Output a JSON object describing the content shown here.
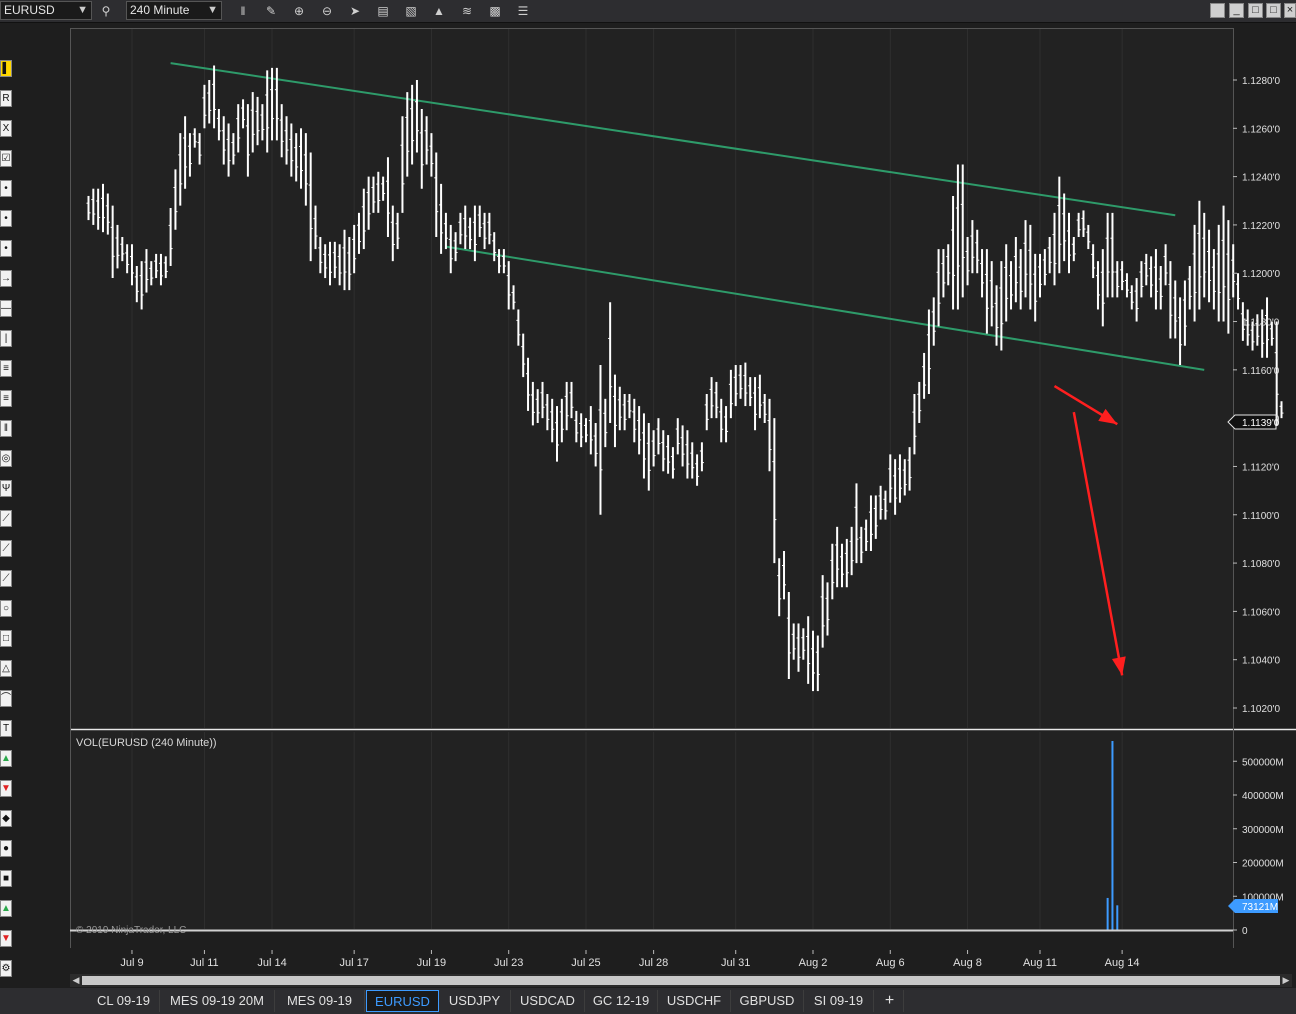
{
  "toolbar": {
    "instrument": "EURUSD",
    "interval": "240 Minute",
    "icons": [
      "search-icon",
      "bars-type-icon",
      "draw-icon",
      "zoom-in-icon",
      "zoom-out-icon",
      "pointer-icon",
      "data-box-icon",
      "properties-icon",
      "indicators-icon",
      "strategies-icon",
      "templates-icon",
      "grid-icon"
    ]
  },
  "chart_data": {
    "type": "ohlc-bar",
    "instrument": "EURUSD",
    "interval": "240 Minute",
    "price_axis": {
      "min": 1.101,
      "max": 1.1295,
      "ticks": [
        "1.1280'0",
        "1.1260'0",
        "1.1240'0",
        "1.1220'0",
        "1.1200'0",
        "1.1180'0",
        "1.1160'0",
        "1.1140'0",
        "1.1120'0",
        "1.1100'0",
        "1.1080'0",
        "1.1060'0",
        "1.1040'0",
        "1.1020'0"
      ],
      "tick_values": [
        1.128,
        1.126,
        1.124,
        1.122,
        1.12,
        1.118,
        1.116,
        1.114,
        1.112,
        1.11,
        1.108,
        1.106,
        1.104,
        1.102
      ],
      "last_price_label": "1.1139'0",
      "last_price": 1.1139
    },
    "x_axis": {
      "labels": [
        "Jul 9",
        "Jul 11",
        "Jul 14",
        "Jul 17",
        "Jul 19",
        "Jul 23",
        "Jul 25",
        "Jul 28",
        "Jul 31",
        "Aug 2",
        "Aug 6",
        "Aug 8",
        "Aug 11",
        "Aug 14"
      ],
      "bar_index": [
        9,
        24,
        38,
        55,
        71,
        87,
        103,
        117,
        134,
        150,
        166,
        182,
        197,
        214
      ]
    },
    "bars": [
      [
        1.1222,
        1.1232
      ],
      [
        1.122,
        1.1235
      ],
      [
        1.1218,
        1.1235
      ],
      [
        1.1217,
        1.1237
      ],
      [
        1.1216,
        1.1233
      ],
      [
        1.1198,
        1.1228
      ],
      [
        1.1202,
        1.122
      ],
      [
        1.1205,
        1.1215
      ],
      [
        1.12,
        1.1212
      ],
      [
        1.1195,
        1.1212
      ],
      [
        1.1188,
        1.1203
      ],
      [
        1.1185,
        1.1205
      ],
      [
        1.1192,
        1.121
      ],
      [
        1.1195,
        1.1205
      ],
      [
        1.1198,
        1.1208
      ],
      [
        1.1195,
        1.1208
      ],
      [
        1.1198,
        1.1207
      ],
      [
        1.1203,
        1.1227
      ],
      [
        1.1218,
        1.1243
      ],
      [
        1.1228,
        1.1258
      ],
      [
        1.1235,
        1.1265
      ],
      [
        1.124,
        1.1258
      ],
      [
        1.1252,
        1.126
      ],
      [
        1.1245,
        1.1258
      ],
      [
        1.126,
        1.1278
      ],
      [
        1.1262,
        1.128
      ],
      [
        1.126,
        1.1286
      ],
      [
        1.1255,
        1.1268
      ],
      [
        1.1245,
        1.1265
      ],
      [
        1.124,
        1.1262
      ],
      [
        1.1245,
        1.1258
      ],
      [
        1.125,
        1.127
      ],
      [
        1.126,
        1.1272
      ],
      [
        1.124,
        1.127
      ],
      [
        1.125,
        1.1275
      ],
      [
        1.1253,
        1.1273
      ],
      [
        1.1255,
        1.127
      ],
      [
        1.125,
        1.1284
      ],
      [
        1.1255,
        1.1285
      ],
      [
        1.1255,
        1.1285
      ],
      [
        1.1248,
        1.127
      ],
      [
        1.1245,
        1.1265
      ],
      [
        1.124,
        1.1262
      ],
      [
        1.1238,
        1.1258
      ],
      [
        1.1235,
        1.126
      ],
      [
        1.1228,
        1.1258
      ],
      [
        1.1205,
        1.125
      ],
      [
        1.121,
        1.1228
      ],
      [
        1.12,
        1.1215
      ],
      [
        1.1198,
        1.1212
      ],
      [
        1.1195,
        1.1213
      ],
      [
        1.1198,
        1.1213
      ],
      [
        1.1195,
        1.1212
      ],
      [
        1.1193,
        1.1218
      ],
      [
        1.1193,
        1.1215
      ],
      [
        1.12,
        1.122
      ],
      [
        1.1208,
        1.1225
      ],
      [
        1.121,
        1.1235
      ],
      [
        1.1218,
        1.124
      ],
      [
        1.1225,
        1.124
      ],
      [
        1.1225,
        1.1242
      ],
      [
        1.123,
        1.124
      ],
      [
        1.1215,
        1.1248
      ],
      [
        1.1205,
        1.1228
      ],
      [
        1.121,
        1.1225
      ],
      [
        1.1225,
        1.1265
      ],
      [
        1.124,
        1.1275
      ],
      [
        1.1245,
        1.1278
      ],
      [
        1.125,
        1.128
      ],
      [
        1.1235,
        1.1268
      ],
      [
        1.1245,
        1.1265
      ],
      [
        1.124,
        1.1258
      ],
      [
        1.1215,
        1.125
      ],
      [
        1.1208,
        1.1237
      ],
      [
        1.121,
        1.1225
      ],
      [
        1.12,
        1.122
      ],
      [
        1.1205,
        1.1217
      ],
      [
        1.1212,
        1.1225
      ],
      [
        1.121,
        1.1228
      ],
      [
        1.121,
        1.1223
      ],
      [
        1.1205,
        1.1228
      ],
      [
        1.1215,
        1.1228
      ],
      [
        1.121,
        1.1225
      ],
      [
        1.1212,
        1.1225
      ],
      [
        1.1205,
        1.1217
      ],
      [
        1.12,
        1.121
      ],
      [
        1.12,
        1.121
      ],
      [
        1.1185,
        1.1205
      ],
      [
        1.1185,
        1.1195
      ],
      [
        1.117,
        1.1185
      ],
      [
        1.1157,
        1.1175
      ],
      [
        1.1143,
        1.1165
      ],
      [
        1.1137,
        1.1155
      ],
      [
        1.1138,
        1.1152
      ],
      [
        1.114,
        1.1155
      ],
      [
        1.1135,
        1.115
      ],
      [
        1.113,
        1.1148
      ],
      [
        1.1122,
        1.1145
      ],
      [
        1.113,
        1.1148
      ],
      [
        1.1135,
        1.1155
      ],
      [
        1.114,
        1.1155
      ],
      [
        1.113,
        1.1143
      ],
      [
        1.1128,
        1.1142
      ],
      [
        1.113,
        1.114
      ],
      [
        1.1125,
        1.1145
      ],
      [
        1.112,
        1.1138
      ],
      [
        1.11,
        1.1162
      ],
      [
        1.1128,
        1.1148
      ],
      [
        1.1138,
        1.1188
      ],
      [
        1.1128,
        1.1158
      ],
      [
        1.1135,
        1.1153
      ],
      [
        1.1135,
        1.115
      ],
      [
        1.114,
        1.115
      ],
      [
        1.113,
        1.1148
      ],
      [
        1.1125,
        1.1145
      ],
      [
        1.1115,
        1.1142
      ],
      [
        1.111,
        1.1138
      ],
      [
        1.112,
        1.1135
      ],
      [
        1.1125,
        1.114
      ],
      [
        1.1118,
        1.1135
      ],
      [
        1.1117,
        1.1133
      ],
      [
        1.1115,
        1.1128
      ],
      [
        1.1125,
        1.114
      ],
      [
        1.112,
        1.1137
      ],
      [
        1.1115,
        1.1135
      ],
      [
        1.1115,
        1.113
      ],
      [
        1.1112,
        1.1125
      ],
      [
        1.1118,
        1.113
      ],
      [
        1.1135,
        1.115
      ],
      [
        1.114,
        1.1157
      ],
      [
        1.114,
        1.1155
      ],
      [
        1.113,
        1.1148
      ],
      [
        1.113,
        1.1145
      ],
      [
        1.114,
        1.116
      ],
      [
        1.1145,
        1.1162
      ],
      [
        1.1148,
        1.1162
      ],
      [
        1.1145,
        1.1163
      ],
      [
        1.1145,
        1.1157
      ],
      [
        1.1135,
        1.1157
      ],
      [
        1.114,
        1.1158
      ],
      [
        1.1138,
        1.115
      ],
      [
        1.1118,
        1.1148
      ],
      [
        1.108,
        1.114
      ],
      [
        1.1058,
        1.1082
      ],
      [
        1.1065,
        1.1085
      ],
      [
        1.1032,
        1.1068
      ],
      [
        1.104,
        1.1055
      ],
      [
        1.1035,
        1.1055
      ],
      [
        1.104,
        1.1053
      ],
      [
        1.103,
        1.1058
      ],
      [
        1.1027,
        1.1052
      ],
      [
        1.1027,
        1.105
      ],
      [
        1.1045,
        1.1075
      ],
      [
        1.105,
        1.1072
      ],
      [
        1.1065,
        1.1088
      ],
      [
        1.107,
        1.1095
      ],
      [
        1.107,
        1.1088
      ],
      [
        1.107,
        1.109
      ],
      [
        1.1075,
        1.1095
      ],
      [
        1.108,
        1.1113
      ],
      [
        1.108,
        1.1095
      ],
      [
        1.1085,
        1.1098
      ],
      [
        1.1085,
        1.1108
      ],
      [
        1.109,
        1.1108
      ],
      [
        1.1098,
        1.1112
      ],
      [
        1.1098,
        1.111
      ],
      [
        1.1105,
        1.1125
      ],
      [
        1.11,
        1.1123
      ],
      [
        1.1105,
        1.1125
      ],
      [
        1.1108,
        1.1123
      ],
      [
        1.111,
        1.1128
      ],
      [
        1.1125,
        1.115
      ],
      [
        1.1138,
        1.1155
      ],
      [
        1.1148,
        1.1167
      ],
      [
        1.115,
        1.1185
      ],
      [
        1.117,
        1.119
      ],
      [
        1.1178,
        1.121
      ],
      [
        1.119,
        1.121
      ],
      [
        1.1195,
        1.1212
      ],
      [
        1.1185,
        1.1232
      ],
      [
        1.1185,
        1.1245
      ],
      [
        1.119,
        1.1245
      ],
      [
        1.1195,
        1.1215
      ],
      [
        1.12,
        1.1222
      ],
      [
        1.12,
        1.1218
      ],
      [
        1.119,
        1.121
      ],
      [
        1.1175,
        1.121
      ],
      [
        1.1178,
        1.1205
      ],
      [
        1.117,
        1.1195
      ],
      [
        1.1168,
        1.1205
      ],
      [
        1.118,
        1.1212
      ],
      [
        1.1185,
        1.1205
      ],
      [
        1.1188,
        1.1215
      ],
      [
        1.1185,
        1.121
      ],
      [
        1.119,
        1.1222
      ],
      [
        1.1185,
        1.122
      ],
      [
        1.118,
        1.1208
      ],
      [
        1.119,
        1.1208
      ],
      [
        1.1195,
        1.121
      ],
      [
        1.12,
        1.1215
      ],
      [
        1.1195,
        1.1225
      ],
      [
        1.12,
        1.124
      ],
      [
        1.1205,
        1.1233
      ],
      [
        1.12,
        1.1225
      ],
      [
        1.1205,
        1.1215
      ],
      [
        1.1215,
        1.1225
      ],
      [
        1.1215,
        1.1226
      ],
      [
        1.121,
        1.122
      ],
      [
        1.1198,
        1.1212
      ],
      [
        1.1185,
        1.1205
      ],
      [
        1.1178,
        1.121
      ],
      [
        1.119,
        1.1225
      ],
      [
        1.119,
        1.1225
      ],
      [
        1.119,
        1.1205
      ],
      [
        1.1193,
        1.1205
      ],
      [
        1.119,
        1.12
      ],
      [
        1.1185,
        1.1195
      ],
      [
        1.118,
        1.1198
      ],
      [
        1.119,
        1.1205
      ],
      [
        1.1195,
        1.1208
      ],
      [
        1.119,
        1.1207
      ],
      [
        1.1185,
        1.121
      ],
      [
        1.1185,
        1.1203
      ],
      [
        1.1195,
        1.1212
      ],
      [
        1.1173,
        1.1205
      ],
      [
        1.1173,
        1.1197
      ],
      [
        1.1162,
        1.119
      ],
      [
        1.117,
        1.1197
      ],
      [
        1.1185,
        1.1203
      ],
      [
        1.118,
        1.122
      ],
      [
        1.1185,
        1.123
      ],
      [
        1.119,
        1.1225
      ],
      [
        1.1188,
        1.1218
      ],
      [
        1.1185,
        1.121
      ],
      [
        1.118,
        1.122
      ],
      [
        1.118,
        1.1228
      ],
      [
        1.1175,
        1.1222
      ],
      [
        1.119,
        1.1212
      ],
      [
        1.1185,
        1.12
      ],
      [
        1.1172,
        1.1188
      ],
      [
        1.117,
        1.1185
      ],
      [
        1.1168,
        1.118
      ],
      [
        1.117,
        1.1183
      ],
      [
        1.1165,
        1.1185
      ],
      [
        1.1165,
        1.119
      ],
      [
        1.117,
        1.118
      ],
      [
        1.1137,
        1.118
      ],
      [
        1.114,
        1.1147
      ]
    ],
    "trendlines": [
      {
        "name": "upper-channel-line",
        "color": "#2e9b6a",
        "p1": [
          17,
          1.1287
        ],
        "p2": [
          225,
          1.1224
        ]
      },
      {
        "name": "lower-channel-line",
        "color": "#2e9b6a",
        "p1": [
          74,
          1.1211
        ],
        "p2": [
          231,
          1.116
        ]
      }
    ],
    "arrows": [
      {
        "name": "short-red-arrow",
        "color": "#ff1f1f",
        "from": [
          200,
          1.11533
        ],
        "to": [
          213,
          1.11375
        ]
      },
      {
        "name": "long-red-arrow",
        "color": "#ff1f1f",
        "from": [
          204,
          1.11425
        ],
        "to": [
          214,
          1.10335
        ]
      }
    ],
    "volume": {
      "title": "VOL(EURUSD (240 Minute))",
      "ticks": [
        "500000M",
        "400000M",
        "300000M",
        "200000M",
        "100000M",
        "0"
      ],
      "tick_values": [
        500000,
        400000,
        300000,
        200000,
        100000,
        0
      ],
      "max": 560000,
      "last_label": "73121M",
      "color": "#3d9bff",
      "bars": [
        [
          211,
          95000
        ],
        [
          212,
          575000
        ],
        [
          213,
          73121
        ]
      ]
    },
    "copyright": "© 2019 NinjaTrader, LLC"
  },
  "left_tools": [
    "marker-tool-icon",
    "ruler-tool-icon",
    "risk-reward-tool-icon",
    "region-tool-icon",
    "line-tool-icon",
    "ray-tool-icon",
    "extended-line-icon",
    "arrow-line-icon",
    "horizontal-line-icon",
    "vertical-line-icon",
    "fib-retracement-icon",
    "fib-extension-icon",
    "fib-time-icon",
    "fib-circle-icon",
    "andrews-pitchfork-icon",
    "gann-fan-icon",
    "regression-channel-icon",
    "trend-channel-icon",
    "ellipse-tool-icon",
    "rectangle-tool-icon",
    "triangle-tool-icon",
    "arc-tool-icon",
    "text-tool-icon",
    "arrow-up-icon",
    "arrow-down-icon",
    "diamond-icon",
    "dot-icon",
    "square-icon",
    "triangle-up-icon",
    "triangle-down-icon",
    "settings-tool-icon"
  ],
  "tabs": [
    {
      "label": "CL 09-19",
      "active": false
    },
    {
      "label": "MES 09-19 20M",
      "active": false
    },
    {
      "label": "MES 09-19",
      "active": false
    },
    {
      "label": "EURUSD",
      "active": true
    },
    {
      "label": "USDJPY",
      "active": false
    },
    {
      "label": "USDCAD",
      "active": false
    },
    {
      "label": "GC 12-19",
      "active": false
    },
    {
      "label": "USDCHF",
      "active": false
    },
    {
      "label": "GBPUSD",
      "active": false
    },
    {
      "label": "SI 09-19",
      "active": false
    }
  ],
  "add_tab_label": "+"
}
